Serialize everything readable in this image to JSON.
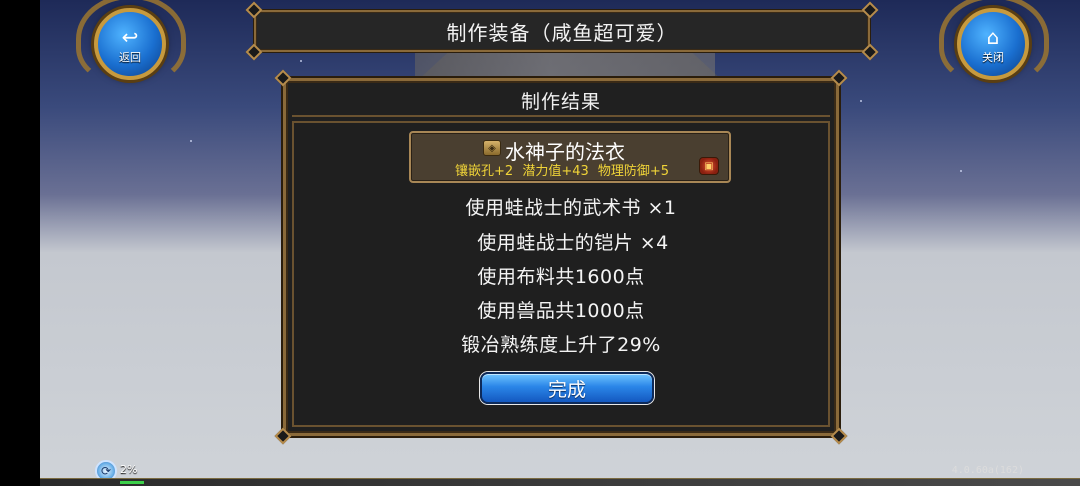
{
  "header": {
    "title": "制作装备（咸鱼超可爱）",
    "back_label": "返回",
    "back_icon": "back-arrow-icon",
    "close_label": "关闭",
    "close_icon": "home-icon"
  },
  "result_panel": {
    "title": "制作结果",
    "item": {
      "name": "水神子的法衣",
      "stats": [
        "镶嵌孔+2",
        "潜力值+43",
        "物理防御+5"
      ]
    },
    "lines": [
      "使用蛙战士的武术书 ×1",
      "使用蛙战士的铠片 ×4",
      "使用布料共1600点",
      "使用兽品共1000点",
      "锻冶熟练度上升了29%"
    ],
    "confirm_label": "完成"
  },
  "status": {
    "percent": "2%",
    "version": "4.0.60a(162)"
  },
  "colors": {
    "stat_yellow": "#f0d438",
    "frame_gold": "#8a6a3a",
    "button_blue": "#2a86e8"
  }
}
